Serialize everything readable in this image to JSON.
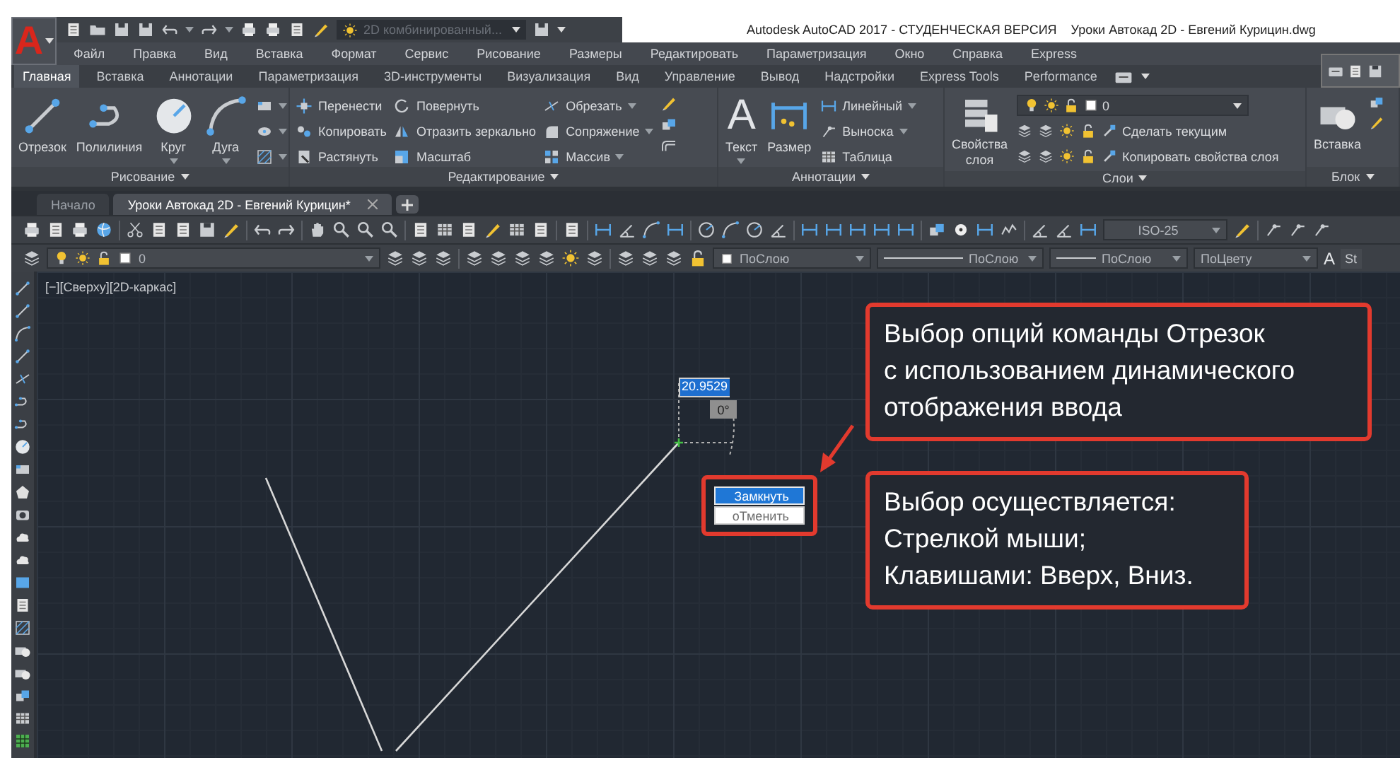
{
  "logo": "A",
  "workspace": "2D комбинированный...",
  "title": "Autodesk AutoCAD 2017 - СТУДЕНЧЕСКАЯ ВЕРСИЯ    Уроки Автокад 2D - Евгений Курицин.dwg",
  "menu": [
    "Файл",
    "Правка",
    "Вид",
    "Вставка",
    "Формат",
    "Сервис",
    "Рисование",
    "Размеры",
    "Редактировать",
    "Параметризация",
    "Окно",
    "Справка",
    "Express"
  ],
  "ribbon_tabs": [
    {
      "label": "Главная",
      "selected": true
    },
    {
      "label": "Вставка",
      "selected": false
    },
    {
      "label": "Аннотации",
      "selected": false
    },
    {
      "label": "Параметризация",
      "selected": false
    },
    {
      "label": "3D-инструменты",
      "selected": false
    },
    {
      "label": "Визуализация",
      "selected": false
    },
    {
      "label": "Вид",
      "selected": false
    },
    {
      "label": "Управление",
      "selected": false
    },
    {
      "label": "Вывод",
      "selected": false
    },
    {
      "label": "Надстройки",
      "selected": false
    },
    {
      "label": "Express Tools",
      "selected": false
    },
    {
      "label": "Performance",
      "selected": false
    }
  ],
  "draw_panel": {
    "title": "Рисование",
    "tools": [
      {
        "label": "Отрезок",
        "dropdown": false
      },
      {
        "label": "Полилиния",
        "dropdown": false
      },
      {
        "label": "Круг",
        "dropdown": true
      },
      {
        "label": "Дуга",
        "dropdown": true
      }
    ]
  },
  "modify_panel": {
    "title": "Редактирование",
    "columns": [
      [
        {
          "label": "Перенести",
          "dropdown": false
        },
        {
          "label": "Копировать",
          "dropdown": false
        },
        {
          "label": "Растянуть",
          "dropdown": false
        }
      ],
      [
        {
          "label": "Повернуть",
          "dropdown": false
        },
        {
          "label": "Отразить зеркально",
          "dropdown": false
        },
        {
          "label": "Масштаб",
          "dropdown": false
        }
      ],
      [
        {
          "label": "Обрезать",
          "dropdown": true
        },
        {
          "label": "Сопряжение",
          "dropdown": true
        },
        {
          "label": "Массив",
          "dropdown": true
        }
      ]
    ]
  },
  "annotation_panel": {
    "title": "Аннотации",
    "text_glyph": "A",
    "tools": [
      {
        "label": "Текст",
        "dropdown": true
      },
      {
        "label": "Размер",
        "dropdown": false
      }
    ],
    "small_tools": [
      {
        "label": "Линейный",
        "dropdown": true
      },
      {
        "label": "Выноска",
        "dropdown": true
      },
      {
        "label": "Таблица",
        "dropdown": false
      }
    ]
  },
  "layers_panel": {
    "title": "Слои",
    "tool": "Свойства\nслоя",
    "layer": "0",
    "actions": [
      "Сделать текущим",
      "Копировать свойства слоя"
    ]
  },
  "block_panel": {
    "title": "Блок",
    "tool": "Вставка"
  },
  "file_tabs": [
    {
      "label": "Начало",
      "selected": false
    },
    {
      "label": "Уроки Автокад 2D - Евгений Курицин*",
      "selected": true
    }
  ],
  "dim_style": "ISO-25",
  "properties": {
    "layer": "0",
    "color_value": "ПоСлою",
    "linetype": "ПоСлою",
    "lineweight": "ПоСлою",
    "plot_style": "ПоЦвету",
    "text_style_glyph": "A",
    "text_style": "St"
  },
  "viewport_label": "[−][Сверху][2D-каркас]",
  "dynamic_input": {
    "length": "20.9529",
    "angle": "0°"
  },
  "options_menu": [
    {
      "label": "Замкнуть",
      "selected": true
    },
    {
      "label": "оТменить",
      "selected": false
    }
  ],
  "callouts": [
    "Выбор опций команды Отрезок\nс использованием динамического\nотображения ввода",
    "Выбор осуществляется:\nСтрелкой мыши;\nКлавишами: Вверх, Вниз."
  ]
}
